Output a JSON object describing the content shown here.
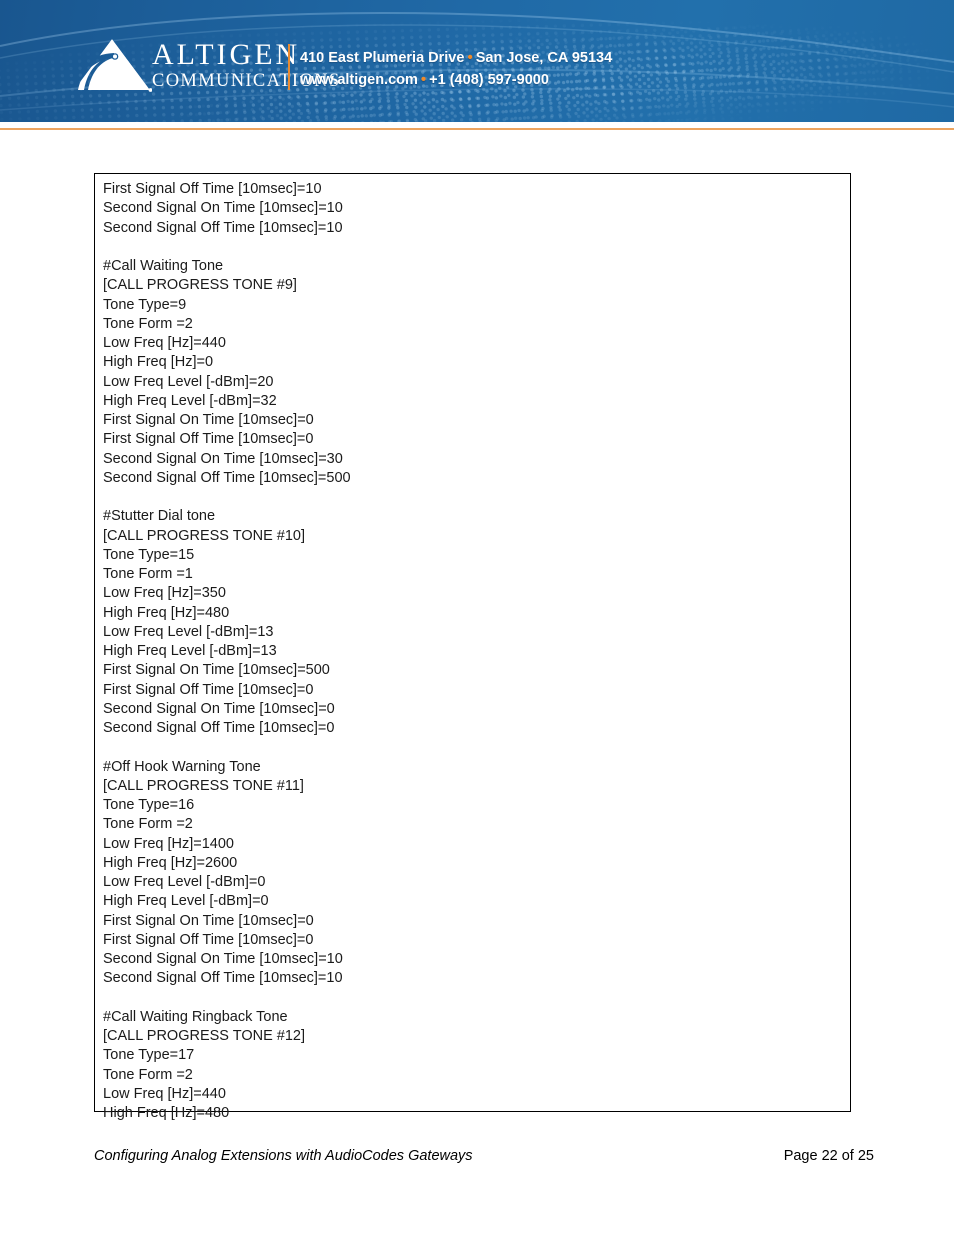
{
  "header": {
    "logo": {
      "brand_line1": "ALTIGEN",
      "brand_line2": "COMMUNICATIONS",
      "mark_name": "altigen-triangle-logo"
    },
    "contact": {
      "address": "410 East Plumeria Drive",
      "city_state_zip": "San Jose, CA 95134",
      "website": "www.altigen.com",
      "phone": "+1 (408) 597-9000",
      "separator": "•"
    },
    "colors": {
      "banner_blue": "#2069a6",
      "banner_blue_dark": "#19568f",
      "accent_orange": "#eda45f",
      "separator_orange": "#e98b32"
    }
  },
  "content_box": {
    "name": "configuration-listing",
    "lines": [
      "First Signal Off Time [10msec]=10",
      "Second Signal On Time [10msec]=10",
      "Second Signal Off Time [10msec]=10",
      "",
      "#Call Waiting Tone",
      "[CALL PROGRESS TONE #9]",
      "Tone Type=9",
      "Tone Form =2",
      "Low Freq [Hz]=440",
      "High Freq [Hz]=0",
      "Low Freq Level [-dBm]=20",
      "High Freq Level [-dBm]=32",
      "First Signal On Time [10msec]=0",
      "First Signal Off Time [10msec]=0",
      "Second Signal On Time [10msec]=30",
      "Second Signal Off Time [10msec]=500",
      "",
      "#Stutter Dial tone",
      "[CALL PROGRESS TONE #10]",
      "Tone Type=15",
      "Tone Form =1",
      "Low Freq [Hz]=350",
      "High Freq [Hz]=480",
      "Low Freq Level [-dBm]=13",
      "High Freq Level [-dBm]=13",
      "First Signal On Time [10msec]=500",
      "First Signal Off Time [10msec]=0",
      "Second Signal On Time [10msec]=0",
      "Second Signal Off Time [10msec]=0",
      "",
      "#Off Hook Warning Tone",
      "[CALL PROGRESS TONE #11]",
      "Tone Type=16",
      "Tone Form =2",
      "Low Freq [Hz]=1400",
      "High Freq [Hz]=2600",
      "Low Freq Level [-dBm]=0",
      "High Freq Level [-dBm]=0",
      "First Signal On Time [10msec]=0",
      "First Signal Off Time [10msec]=0",
      "Second Signal On Time [10msec]=10",
      "Second Signal Off Time [10msec]=10",
      "",
      "#Call Waiting Ringback Tone",
      "[CALL PROGRESS TONE #12]",
      "Tone Type=17",
      "Tone Form =2",
      "Low Freq [Hz]=440",
      "High Freq [Hz]=480"
    ]
  },
  "footer": {
    "document_title": "Configuring Analog Extensions with AudioCodes Gateways",
    "page_label": "Page 22 of 25"
  }
}
